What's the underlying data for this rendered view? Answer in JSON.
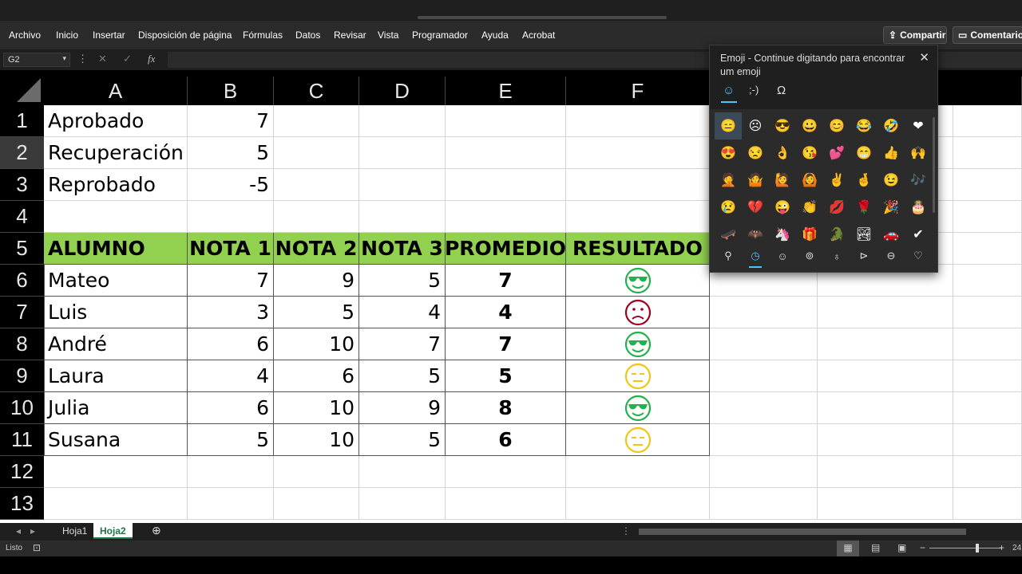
{
  "ribbon": {
    "menus": [
      "Archivo",
      "Inicio",
      "Insertar",
      "Disposición de página",
      "Fórmulas",
      "Datos",
      "Revisar",
      "Vista",
      "Programador",
      "Ayuda",
      "Acrobat"
    ],
    "share_label": "Compartir",
    "comments_label": "Comentarios"
  },
  "formula_bar": {
    "name_box": "G2",
    "fx_label": "fx"
  },
  "columns": [
    "A",
    "B",
    "C",
    "D",
    "E",
    "F"
  ],
  "rows": [
    "1",
    "2",
    "3",
    "4",
    "5",
    "6",
    "7",
    "8",
    "9",
    "10",
    "11",
    "12",
    "13"
  ],
  "params": [
    {
      "label": "Aprobado",
      "value": "7"
    },
    {
      "label": "Recuperación",
      "value": "5"
    },
    {
      "label": "Reprobado",
      "value": "-5"
    }
  ],
  "table": {
    "headers": [
      "ALUMNO",
      "NOTA 1",
      "NOTA 2",
      "NOTA 3",
      "PROMEDIO",
      "RESULTADO"
    ],
    "rows": [
      {
        "name": "Mateo",
        "n1": "7",
        "n2": "9",
        "n3": "5",
        "avg": "7",
        "result": "cool"
      },
      {
        "name": "Luis",
        "n1": "3",
        "n2": "5",
        "n3": "4",
        "avg": "4",
        "result": "sad"
      },
      {
        "name": "André",
        "n1": "6",
        "n2": "10",
        "n3": "7",
        "avg": "7",
        "result": "cool"
      },
      {
        "name": "Laura",
        "n1": "4",
        "n2": "6",
        "n3": "5",
        "avg": "5",
        "result": "neutral"
      },
      {
        "name": "Julia",
        "n1": "6",
        "n2": "10",
        "n3": "9",
        "avg": "8",
        "result": "cool"
      },
      {
        "name": "Susana",
        "n1": "5",
        "n2": "10",
        "n3": "5",
        "avg": "6",
        "result": "neutral"
      }
    ]
  },
  "colors": {
    "header_green": "#92d050",
    "cool": "#22b14c",
    "sad": "#a0001e",
    "neutral": "#f0c419"
  },
  "sheet_tabs": [
    "Hoja1",
    "Hoja2"
  ],
  "active_tab": "Hoja2",
  "status": {
    "text": "Listo",
    "zoom": "24"
  },
  "emoji_panel": {
    "title": "Emoji - Continue digitando para encontrar um emoji",
    "tabs": [
      "☺",
      ";-)",
      "Ω"
    ],
    "emojis": [
      "😑",
      "☹",
      "😎",
      "😀",
      "😊",
      "😂",
      "🤣",
      "❤",
      "😍",
      "😒",
      "👌",
      "😘",
      "💕",
      "😁",
      "👍",
      "🙌",
      "🤦",
      "🤷",
      "🙋",
      "🙆",
      "✌",
      "🤞",
      "😉",
      "🎶",
      "😢",
      "💔",
      "😜",
      "👏",
      "💋",
      "🌹",
      "🎉",
      "🎂",
      "🛹",
      "🦇",
      "🦄",
      "🎁",
      "🐊",
      "🏞",
      "🚗",
      "✔"
    ],
    "categories": [
      "search-icon",
      "recent-icon",
      "smiley-icon",
      "people-icon",
      "celebration-icon",
      "food-icon",
      "travel-icon",
      "heart-icon"
    ]
  }
}
